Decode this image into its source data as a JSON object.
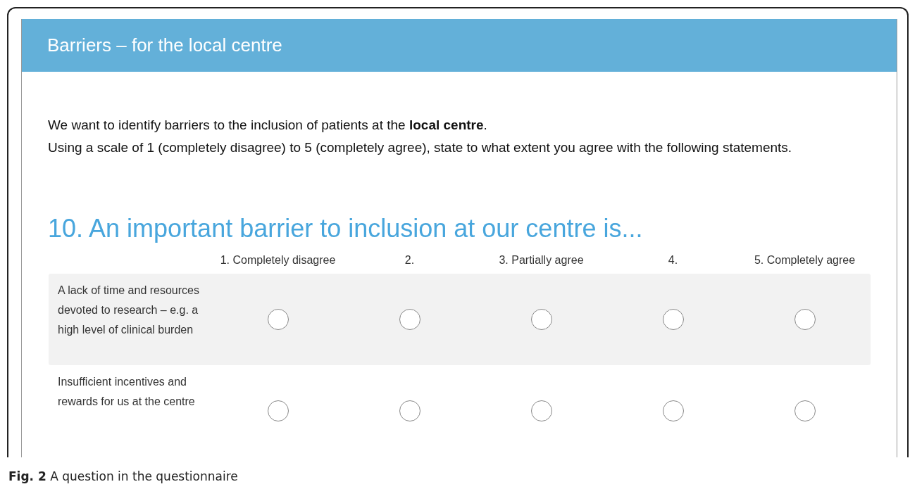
{
  "section": {
    "title": "Barriers – for the local centre"
  },
  "intro": [
    "We want to identify barriers to the inclusion of patients at the **local centre**.",
    "Using a scale of 1 (completely disagree) to 5 (completely agree), state to what extent you agree with the following statements."
  ],
  "question": {
    "title": "10. An important barrier to inclusion at our centre is...",
    "columns": [
      "1. Completely disagree",
      "2.",
      "3. Partially agree",
      "4.",
      "5. Completely agree"
    ],
    "rows": [
      {
        "label": "A lack of time and resources devoted to research – e.g. a high level of clinical burden",
        "options": [
          {
            "selected": false
          },
          {
            "selected": false
          },
          {
            "selected": false
          },
          {
            "selected": false
          },
          {
            "selected": false
          }
        ]
      },
      {
        "label": "Insufficient incentives and rewards for us at the centre",
        "options": [
          {
            "selected": false
          },
          {
            "selected": false
          },
          {
            "selected": false
          },
          {
            "selected": false
          },
          {
            "selected": false
          }
        ]
      }
    ]
  },
  "caption": {
    "label": "Fig. 2",
    "text": "A question in the questionnaire"
  }
}
